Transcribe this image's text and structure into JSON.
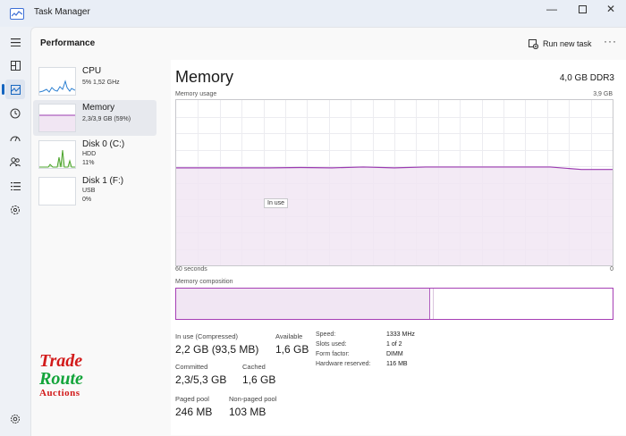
{
  "window": {
    "title": "Task Manager"
  },
  "header": {
    "page_title": "Performance",
    "run_task": "Run new task"
  },
  "sidebar": {
    "items": [
      {
        "name": "CPU",
        "sub1": "5%  1,52 GHz",
        "sub2": "",
        "color": "#2b7fd1"
      },
      {
        "name": "Memory",
        "sub1": "2,3/3,9 GB (59%)",
        "sub2": "",
        "color": "#9b3bb0"
      },
      {
        "name": "Disk 0 (C:)",
        "sub1": "HDD",
        "sub2": "11%",
        "color": "#4ca42c"
      },
      {
        "name": "Disk 1 (F:)",
        "sub1": "USB",
        "sub2": "0%",
        "color": "#4ca42c"
      }
    ]
  },
  "memory": {
    "title": "Memory",
    "spec": "4,0 GB DDR3",
    "usage_label": "Memory usage",
    "usage_max": "3,9 GB",
    "time_left": "60 seconds",
    "time_right": "0",
    "tooltip": "In use",
    "composition_label": "Memory composition",
    "usage_series_fraction": [
      0.59,
      0.59,
      0.59,
      0.59,
      0.592,
      0.59,
      0.595,
      0.59,
      0.595,
      0.595,
      0.595,
      0.595,
      0.595,
      0.58,
      0.58
    ],
    "composition": {
      "in_use_fraction": 0.58,
      "modified_fraction": 0.008
    }
  },
  "stats": {
    "in_use_label": "In use (Compressed)",
    "in_use_value": "2,2 GB (93,5 MB)",
    "available_label": "Available",
    "available_value": "1,6 GB",
    "committed_label": "Committed",
    "committed_value": "2,3/5,3 GB",
    "cached_label": "Cached",
    "cached_value": "1,6 GB",
    "paged_label": "Paged pool",
    "paged_value": "246 MB",
    "nonpaged_label": "Non-paged pool",
    "nonpaged_value": "103 MB"
  },
  "specs": {
    "speed_label": "Speed:",
    "speed_value": "1333 MHz",
    "slots_label": "Slots used:",
    "slots_value": "1 of 2",
    "form_label": "Form factor:",
    "form_value": "DIMM",
    "reserved_label": "Hardware reserved:",
    "reserved_value": "116 MB"
  },
  "watermark": {
    "line1": "Trade",
    "line2": "Route",
    "line3": "Auctions"
  },
  "colors": {
    "accent": "#9b3bb0",
    "fill": "#f1e6f3",
    "cpu": "#2b7fd1",
    "disk": "#4ca42c"
  }
}
